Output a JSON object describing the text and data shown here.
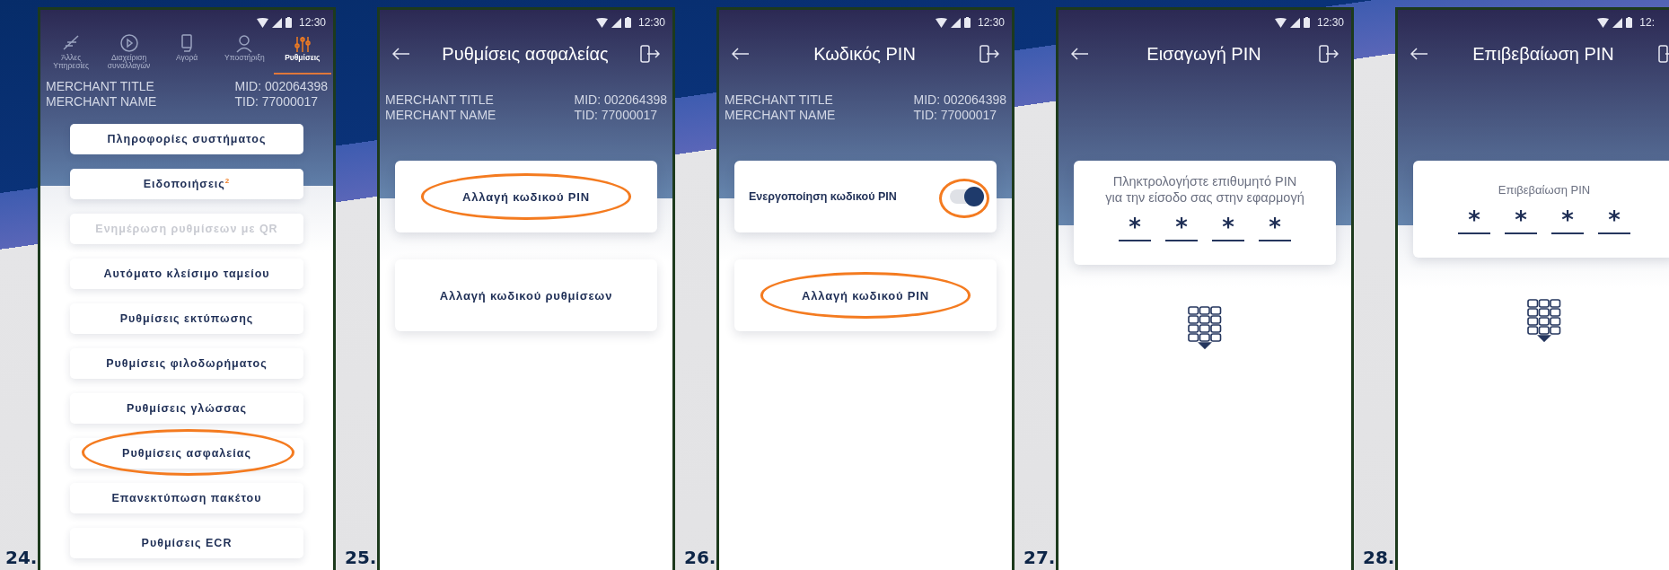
{
  "screens": [
    {
      "step": "24.",
      "kind": "menu",
      "status_time": "12:30",
      "tabs": [
        {
          "label": "Άλλες Υπηρεσίες",
          "selected": false
        },
        {
          "label": "Διαχείριση συναλλαγών",
          "selected": false
        },
        {
          "label": "Αγορά",
          "selected": false
        },
        {
          "label": "Υποστήριξη",
          "selected": false
        },
        {
          "label": "Ρυθμίσεις",
          "selected": true
        }
      ],
      "merchant": {
        "title": "MERCHANT TITLE",
        "name": "MERCHANT NAME",
        "mid": "MID: 002064398",
        "tid": "TID: 77000017"
      },
      "items": [
        {
          "label": "Πληροφορίες συστήματος",
          "disabled": false,
          "circled": false
        },
        {
          "label": "Ειδοποιήσεις",
          "badge": "2",
          "disabled": false,
          "circled": false
        },
        {
          "label": "Ενημέρωση ρυθμίσεων με QR",
          "disabled": true,
          "circled": false
        },
        {
          "label": "Αυτόματο κλείσιμο ταμείου",
          "disabled": false,
          "circled": false
        },
        {
          "label": "Ρυθμίσεις εκτύπωσης",
          "disabled": false,
          "circled": false
        },
        {
          "label": "Ρυθμίσεις φιλοδωρήματος",
          "disabled": false,
          "circled": false
        },
        {
          "label": "Ρυθμίσεις γλώσσας",
          "disabled": false,
          "circled": false
        },
        {
          "label": "Ρυθμίσεις ασφαλείας",
          "disabled": false,
          "circled": true
        },
        {
          "label": "Επανεκτύπωση πακέτου",
          "disabled": false,
          "circled": false
        },
        {
          "label": "Ρυθμίσεις ECR",
          "disabled": false,
          "circled": false
        }
      ]
    },
    {
      "step": "25.",
      "kind": "options",
      "status_time": "12:30",
      "title": "Ρυθμίσεις ασφαλείας",
      "merchant": {
        "title": "MERCHANT TITLE",
        "name": "MERCHANT NAME",
        "mid": "MID: 002064398",
        "tid": "TID: 77000017"
      },
      "cards": [
        {
          "kind": "button",
          "label": "Αλλαγή κωδικού PIN",
          "circled": true
        },
        {
          "kind": "button",
          "label": "Αλλαγή κωδικού ρυθμίσεων",
          "circled": false
        }
      ]
    },
    {
      "step": "26.",
      "kind": "options",
      "status_time": "12:30",
      "title": "Κωδικός PIN",
      "merchant": {
        "title": "MERCHANT TITLE",
        "name": "MERCHANT NAME",
        "mid": "MID: 002064398",
        "tid": "TID: 77000017"
      },
      "cards": [
        {
          "kind": "toggle",
          "label": "Ενεργοποίηση κωδικού PIN",
          "on": true,
          "circled": true
        },
        {
          "kind": "button",
          "label": "Αλλαγή κωδικού PIN",
          "circled": true
        }
      ]
    },
    {
      "step": "27.",
      "kind": "pin",
      "status_time": "12:30",
      "title": "Εισαγωγή PIN",
      "prompt": [
        "Πληκτρολογήστε επιθυμητό PIN",
        "για την είσοδο σας στην εφαρμογή"
      ],
      "digits": [
        "*",
        "*",
        "*",
        "*"
      ]
    },
    {
      "step": "28.",
      "kind": "pin",
      "status_time": "12:",
      "title": "Επιβεβαίωση PIN",
      "prompt": [
        "Επιβεβαίωση PIN"
      ],
      "digits": [
        "*",
        "*",
        "*",
        "*"
      ]
    }
  ]
}
